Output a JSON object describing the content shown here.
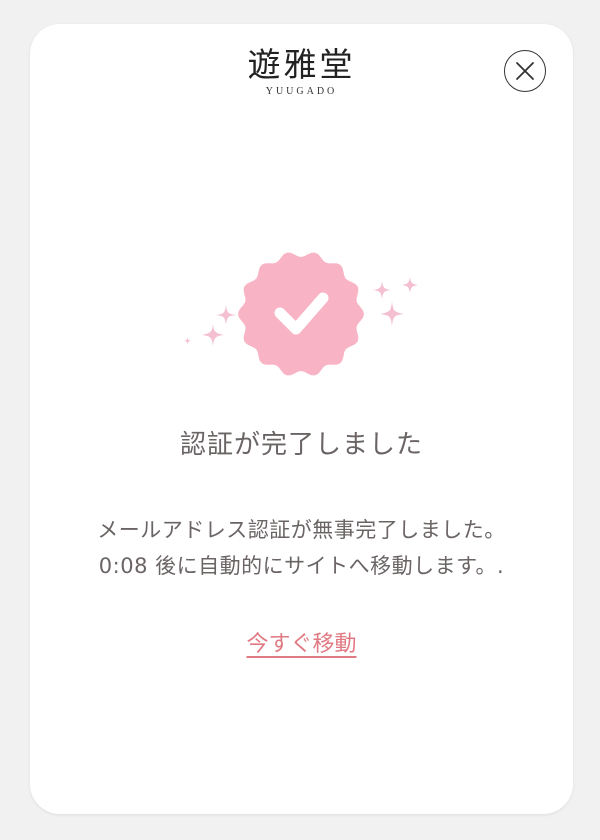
{
  "brand": {
    "logo_main": "遊雅堂",
    "logo_sub": "YUUGADO"
  },
  "icons": {
    "close": "close-icon",
    "badge": "check-badge-icon",
    "sparkle": "sparkle-icon"
  },
  "colors": {
    "badge": "#f8b3c5",
    "sparkle": "#f4bfd0",
    "link": "#e07a82",
    "text": "#6b6464"
  },
  "main": {
    "heading": "認証が完了しました",
    "message_line1": "メールアドレス認証が無事完了しました。",
    "countdown": "0:08",
    "message_line2_rest": " 後に自動的にサイトへ移動します。.",
    "move_now_link": "今すぐ移動"
  }
}
